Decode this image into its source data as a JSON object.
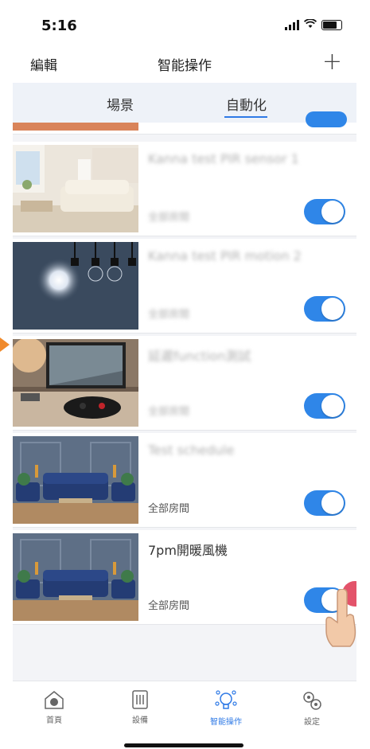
{
  "status_bar": {
    "time": "5:16"
  },
  "nav": {
    "edit_label": "編輯",
    "title": "智能操作",
    "add_label": "+"
  },
  "tabs": [
    {
      "label": "場景"
    },
    {
      "label": "自動化"
    }
  ],
  "automations": [
    {
      "title": "Kanna test PIR sensor 1",
      "room": "全部房間",
      "enabled": true,
      "title_blurred": true,
      "room_blurred": true
    },
    {
      "title": "Kanna test PIR motion 2",
      "room": "全部房間",
      "enabled": true,
      "title_blurred": true,
      "room_blurred": true
    },
    {
      "title": "延遲function測試",
      "room": "全部房間",
      "enabled": true,
      "title_blurred": true,
      "room_blurred": true
    },
    {
      "title": "Test schedule",
      "room": "全部房間",
      "enabled": true,
      "title_blurred": true,
      "room_blurred": false
    },
    {
      "title": "7pm開暖風機",
      "room": "全部房間",
      "enabled": true,
      "title_blurred": false,
      "room_blurred": false
    }
  ],
  "bottom_tabs": [
    {
      "label": "首頁",
      "icon": "home-icon",
      "active": false
    },
    {
      "label": "設備",
      "icon": "device-panel-icon",
      "active": false
    },
    {
      "label": "智能操作",
      "icon": "smart-bulb-icon",
      "active": true
    },
    {
      "label": "設定",
      "icon": "gears-icon",
      "active": false
    }
  ],
  "colors": {
    "accent": "#2f86e8",
    "tab_active": "#2f7ae6",
    "tap_dot": "#e0405a",
    "arrow": "#f08a2c"
  }
}
